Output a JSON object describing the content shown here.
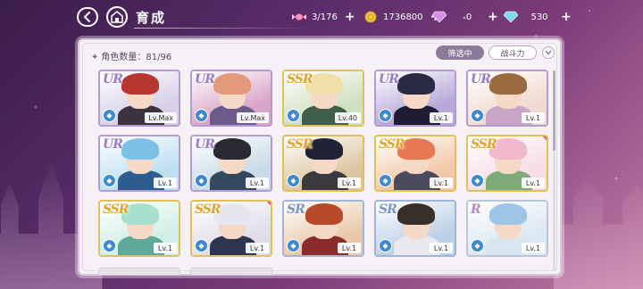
{
  "header": {
    "title": "育成",
    "back_icon": "back-arrow-icon",
    "home_icon": "home-icon"
  },
  "resources": [
    {
      "name": "candy",
      "icon": "candy-icon",
      "value": "3/176",
      "color": "#ff8fb8"
    },
    {
      "name": "gold",
      "icon": "coin-icon",
      "value": "1736800",
      "color": "#f2c542"
    },
    {
      "name": "pink-diamond",
      "icon": "pink-diamond-icon",
      "value": "0",
      "color": "#d78ee8"
    },
    {
      "name": "blue-diamond",
      "icon": "blue-diamond-icon",
      "value": "530",
      "color": "#7fd7f0"
    }
  ],
  "panel": {
    "count_label": "角色数量：81/96",
    "filter_label": "筛选中",
    "sort_label": "战斗力",
    "sort_direction_icon": "chevron-down-icon"
  },
  "cards": [
    {
      "rarity": "UR",
      "level": "Lv.Max",
      "hair": "#b8362e",
      "body": "#3b3340",
      "bg": "#d7d0e8",
      "new": false
    },
    {
      "rarity": "UR",
      "level": "Lv.Max",
      "hair": "#e39a7a",
      "body": "#6b5a8a",
      "bg": "#d8a5c8",
      "new": false
    },
    {
      "rarity": "SSR",
      "level": "Lv.40",
      "hair": "#f0dfa8",
      "body": "#3f5f4a",
      "bg": "#cfe0c0",
      "new": false
    },
    {
      "rarity": "UR",
      "level": "Lv.1",
      "hair": "#2b2a45",
      "body": "#1f1c33",
      "bg": "#b6a8d8",
      "new": false
    },
    {
      "rarity": "UR",
      "level": "Lv.1",
      "hair": "#9a6a3e",
      "body": "#c9a6c8",
      "bg": "#f0dad0",
      "new": false
    },
    {
      "rarity": "UR",
      "level": "Lv.1",
      "hair": "#7bc0e6",
      "body": "#2d5c8e",
      "bg": "#bde0f0",
      "new": false
    },
    {
      "rarity": "UR",
      "level": "Lv.1",
      "hair": "#2a2a33",
      "body": "#34495e",
      "bg": "#c9dbe8",
      "new": false
    },
    {
      "rarity": "SSR",
      "level": "Lv.1",
      "hair": "#222236",
      "body": "#3b3a3f",
      "bg": "#dcc6a2",
      "new": false
    },
    {
      "rarity": "SSR",
      "level": "Lv.1",
      "hair": "#e57a52",
      "body": "#4b4b60",
      "bg": "#f2c8a8",
      "new": false
    },
    {
      "rarity": "SSR",
      "level": "Lv.1",
      "hair": "#f2b8cc",
      "body": "#7eaa7a",
      "bg": "#f6dde6",
      "new": true
    },
    {
      "rarity": "SSR",
      "level": "Lv.1",
      "hair": "#a8e0d0",
      "body": "#5fa89a",
      "bg": "#d0efe6",
      "new": false
    },
    {
      "rarity": "SSR",
      "level": "Lv.1",
      "hair": "#e6e6ef",
      "body": "#2e3550",
      "bg": "#e0dde8",
      "new": true
    },
    {
      "rarity": "SR",
      "level": "Lv.1",
      "hair": "#b84a2a",
      "body": "#8a2c2c",
      "bg": "#e8c8a8",
      "new": false
    },
    {
      "rarity": "SR",
      "level": "Lv.1",
      "hair": "#3a2e2a",
      "body": "#e8e8ee",
      "bg": "#bcd0e6",
      "new": false
    },
    {
      "rarity": "R",
      "level": "Lv.1",
      "hair": "#9ec4e6",
      "body": "#d8e6f0",
      "bg": "#dce8f2",
      "new": false
    }
  ]
}
